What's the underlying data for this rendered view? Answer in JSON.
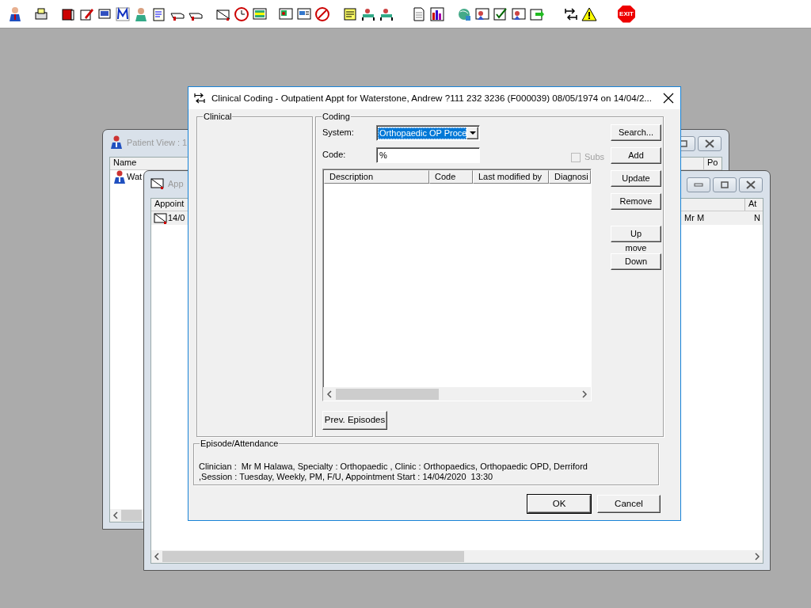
{
  "toolbar": {
    "exit_label": "EXIT"
  },
  "patient_window": {
    "title": "Patient View : 1",
    "columns": [
      "Name",
      "Po"
    ],
    "rows": [
      {
        "cells": [
          "Wat"
        ]
      }
    ]
  },
  "appointments_window": {
    "title": "App",
    "columns": [
      "Appoint",
      "At"
    ],
    "rows": [
      {
        "selected": true,
        "cells": [
          "14/0",
          "Mr M",
          "N"
        ]
      }
    ]
  },
  "dialog": {
    "title": "Clinical Coding - Outpatient Appt for Waterstone, Andrew ?111 232 3236 (F000039) 08/05/1974 on 14/04/2...",
    "clinical_label": "Clinical",
    "coding": {
      "label": "Coding",
      "system_label": "System:",
      "system_value": "Orthopaedic OP Proce",
      "code_label": "Code:",
      "code_value": "%",
      "subs": {
        "label": "Subs",
        "checked": false,
        "disabled": true
      },
      "columns": [
        "Description",
        "Code",
        "Last modified by",
        "Diagnosi"
      ],
      "buttons": [
        "Search...",
        "Add",
        "Update",
        "Remove"
      ],
      "up": "Up",
      "move_label": "move",
      "down": "Down",
      "prev_button": "Prev. Episodes"
    },
    "episode": {
      "label": "Episode/Attendance",
      "lines": [
        "Clinician :  Mr M Halawa, Specialty : Orthopaedic , Clinic : Orthopaedics, Orthopaedic OPD, Derriford",
        ",Session : Tuesday, Weekly, PM, F/U, Appointment Start : 14/04/2020  13:30"
      ]
    },
    "buttons": [
      {
        "label": "OK",
        "default": true
      },
      {
        "label": "Cancel",
        "default": false
      }
    ]
  }
}
